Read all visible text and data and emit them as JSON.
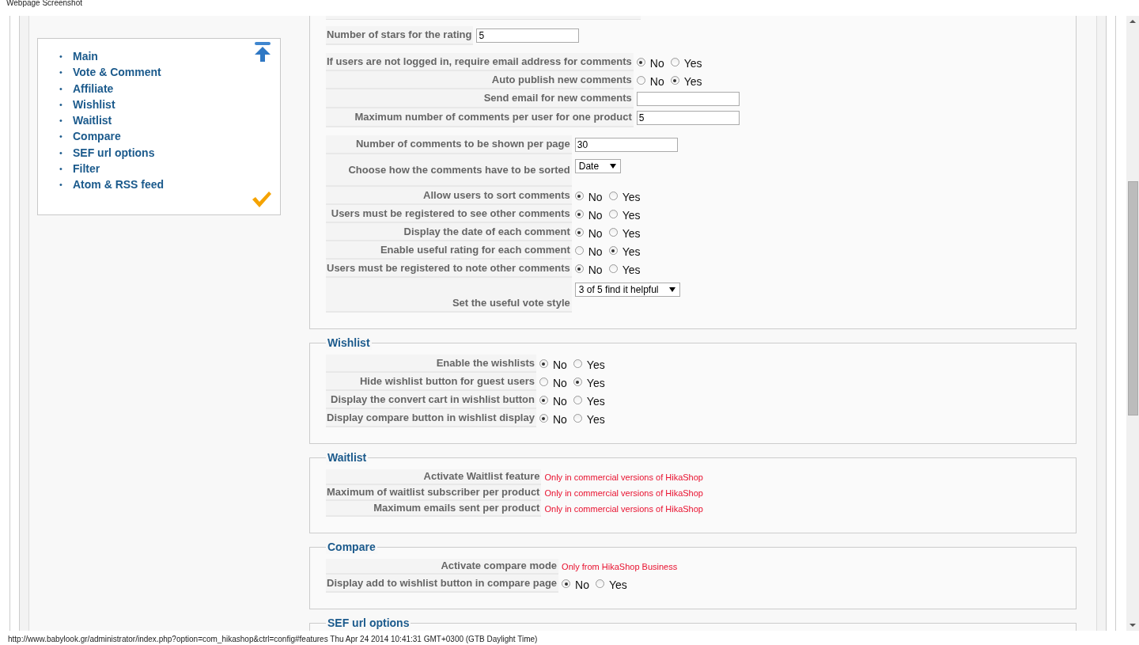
{
  "caption": "Webpage Screenshot",
  "sidebar": {
    "items": [
      {
        "bullet": "•",
        "label": "Main"
      },
      {
        "bullet": "•",
        "label": "Vote & Comment"
      },
      {
        "bullet": "•",
        "label": "Affiliate"
      },
      {
        "bullet": "•",
        "label": "Wishlist"
      },
      {
        "bullet": "•",
        "label": "Waitlist"
      },
      {
        "bullet": "•",
        "label": "Compare"
      },
      {
        "bullet": "•",
        "label": "SEF url options"
      },
      {
        "bullet": "•",
        "label": "Filter"
      },
      {
        "bullet": "•",
        "label": "Atom & RSS feed"
      }
    ]
  },
  "sections": [
    {
      "groups": [
        [
          {
            "kind": "text",
            "label": "Number of stars for the rating",
            "value": "5"
          }
        ],
        [
          {
            "kind": "radio",
            "label": "If users are not logged in, require email address for comments",
            "options": [
              {
                "label": "No",
                "selected": true
              },
              {
                "label": "Yes",
                "selected": false
              }
            ]
          },
          {
            "kind": "radio",
            "label": "Auto publish new comments",
            "options": [
              {
                "label": "No",
                "selected": false
              },
              {
                "label": "Yes",
                "selected": true
              }
            ]
          },
          {
            "kind": "text",
            "label": "Send email for new comments"
          },
          {
            "kind": "text",
            "label": "Maximum number of comments per user for one product",
            "value": "5"
          }
        ],
        [
          {
            "kind": "text",
            "label": "Number of comments to be shown per page",
            "value": "30"
          },
          {
            "kind": "select",
            "label": "Choose how the comments have to be sorted",
            "value": "Date"
          },
          {
            "kind": "radio",
            "label": "Allow users to sort comments",
            "options": [
              {
                "label": "No",
                "selected": true
              },
              {
                "label": "Yes",
                "selected": false
              }
            ]
          },
          {
            "kind": "radio",
            "label": "Users must be registered to see other comments",
            "options": [
              {
                "label": "No",
                "selected": true
              },
              {
                "label": "Yes",
                "selected": false
              }
            ]
          },
          {
            "kind": "radio",
            "label": "Display the date of each comment",
            "options": [
              {
                "label": "No",
                "selected": true
              },
              {
                "label": "Yes",
                "selected": false
              }
            ]
          },
          {
            "kind": "radio",
            "label": "Enable useful rating for each comment",
            "options": [
              {
                "label": "No",
                "selected": false
              },
              {
                "label": "Yes",
                "selected": true
              }
            ]
          },
          {
            "kind": "radio",
            "label": "Users must be registered to note other comments",
            "options": [
              {
                "label": "No",
                "selected": true
              },
              {
                "label": "Yes",
                "selected": false
              }
            ]
          },
          {
            "kind": "select",
            "label": "Set the useful vote style",
            "value": "3 of 5 find it helpful"
          }
        ]
      ]
    },
    {
      "title": "Wishlist",
      "groups": [
        [
          {
            "kind": "radio",
            "label": "Enable the wishlists",
            "options": [
              {
                "label": "No",
                "selected": true
              },
              {
                "label": "Yes",
                "selected": false
              }
            ]
          },
          {
            "kind": "radio",
            "label": "Hide wishlist button for guest users",
            "options": [
              {
                "label": "No",
                "selected": false
              },
              {
                "label": "Yes",
                "selected": true
              }
            ]
          },
          {
            "kind": "radio",
            "label": "Display the convert cart in wishlist button",
            "options": [
              {
                "label": "No",
                "selected": true
              },
              {
                "label": "Yes",
                "selected": false
              }
            ]
          },
          {
            "kind": "radio",
            "label": "Display compare button in wishlist display",
            "options": [
              {
                "label": "No",
                "selected": true
              },
              {
                "label": "Yes",
                "selected": false
              }
            ]
          }
        ]
      ]
    },
    {
      "title": "Waitlist",
      "groups": [
        [
          {
            "kind": "note",
            "label": "Activate Waitlist feature",
            "note": "Only in commercial versions of HikaShop"
          },
          {
            "kind": "note",
            "label": "Maximum of waitlist subscriber per product",
            "note": "Only in commercial versions of HikaShop"
          },
          {
            "kind": "note",
            "label": "Maximum emails sent per product",
            "note": "Only in commercial versions of HikaShop"
          }
        ]
      ]
    },
    {
      "title": "Compare",
      "groups": [
        [
          {
            "kind": "note",
            "label": "Activate compare mode",
            "note": "Only from HikaShop Business"
          },
          {
            "kind": "radio",
            "label": "Display add to wishlist button in compare page",
            "options": [
              {
                "label": "No",
                "selected": true
              },
              {
                "label": "Yes",
                "selected": false
              }
            ]
          }
        ]
      ]
    },
    {
      "title": "SEF url options"
    }
  ],
  "status_bar": "http://www.babylook.gr/administrator/index.php?option=com_hikashop&ctrl=config#features Thu Apr 24 2014 10:41:31 GMT+0300 (GTB Daylight Time)"
}
